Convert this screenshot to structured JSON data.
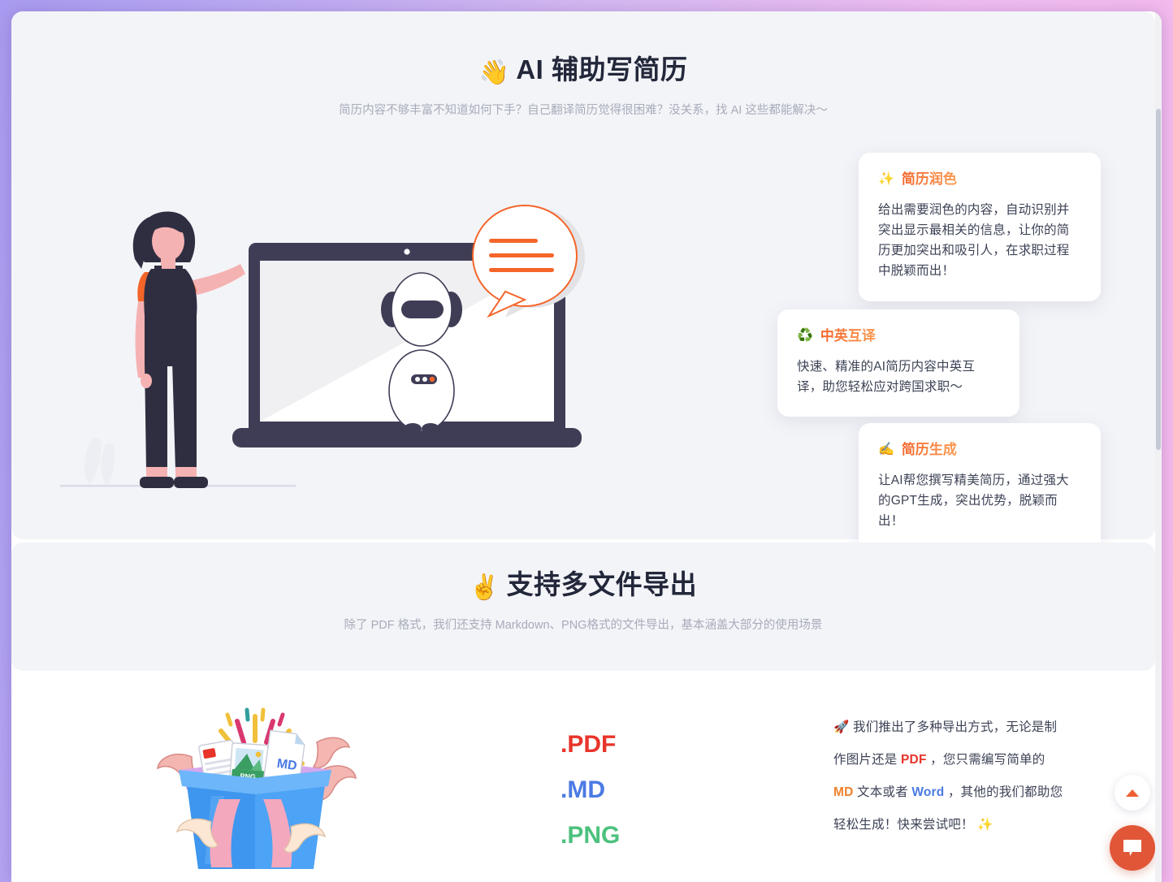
{
  "theme": {
    "page_bg_gradient_from": "#a99bf0",
    "page_bg_gradient_to": "#f5b8ea",
    "panel_bg": "#f3f4f8",
    "card_bg": "#ffffff",
    "heading_color": "#22273a",
    "muted_text": "#a7acb9",
    "body_text": "#3d4356",
    "accent_orange": "#f4652a",
    "accent_orange_light": "#fb9b52",
    "pdf_red": "#e8342a",
    "md_blue": "#4b7ae4",
    "png_green": "#4cc17e",
    "chat_button_bg": "#e15637"
  },
  "ai_section": {
    "title_emoji": "👋",
    "title": "AI 辅助写简历",
    "subtitle": "简历内容不够丰富不知道如何下手？自己翻译简历觉得很困难？没关系，找 AI 这些都能解决～",
    "illustration_name": "woman-with-laptop-chatbot-illustration",
    "cards": [
      {
        "emoji": "✨",
        "title": "简历润色",
        "body": "给出需要润色的内容，自动识别并突出显示最相关的信息，让你的简历更加突出和吸引人，在求职过程中脱颖而出！"
      },
      {
        "emoji": "♻️",
        "title": "中英互译",
        "body": "快速、精准的AI简历内容中英互译，助您轻松应对跨国求职～"
      },
      {
        "emoji": "✍️",
        "title": "简历生成",
        "body": "让AI帮您撰写精美简历，通过强大的GPT生成，突出优势，脱颖而出！"
      }
    ]
  },
  "export_section": {
    "title_emoji": "✌️",
    "title": "支持多文件导出",
    "subtitle": "除了 PDF 格式，我们还支持 Markdown、PNG格式的文件导出，基本涵盖大部分的使用场景",
    "illustration_name": "gift-box-with-files-illustration",
    "formats": [
      {
        "label": ".PDF",
        "color": "#e8342a"
      },
      {
        "label": ".MD",
        "color": "#4b7ae4"
      },
      {
        "label": ".PNG",
        "color": "#4cc17e"
      }
    ],
    "copy": {
      "lead_emoji": "🚀",
      "part1": " 我们推出了多种导出方式，无论是制作图片还是 ",
      "kw1": "PDF",
      "part2": " ，您只需编写简单的 ",
      "kw2": "MD",
      "part3": " 文本或者 ",
      "kw3": "Word",
      "part4": " ，其他的我们都助您轻松生成！快来尝试吧！ ",
      "trail_emoji": "✨"
    }
  },
  "floating": {
    "back_to_top_label": "back-to-top",
    "chat_label": "chat"
  }
}
